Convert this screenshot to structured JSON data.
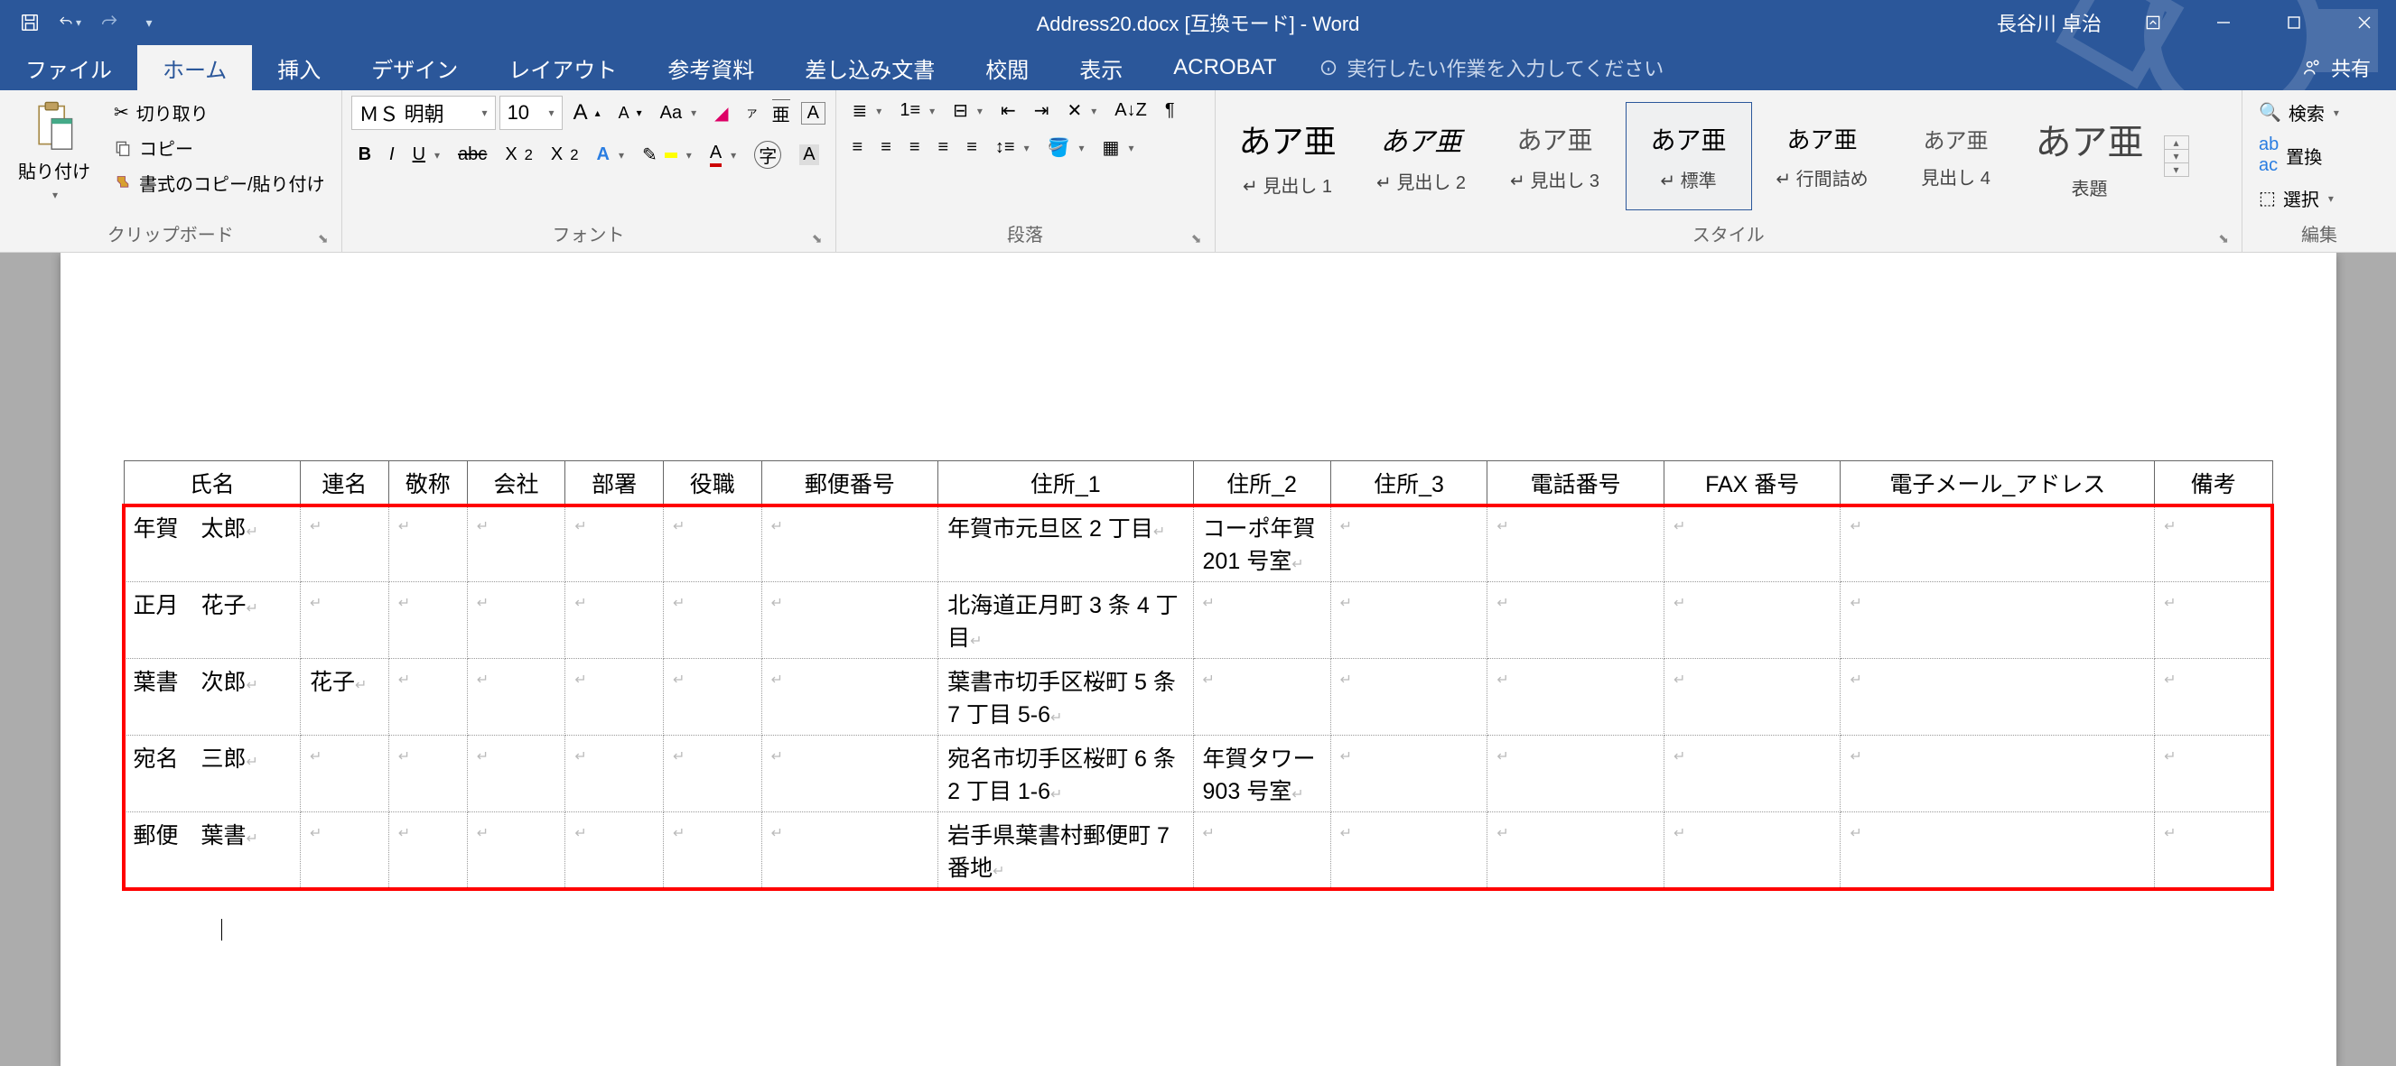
{
  "title": "Address20.docx [互換モード] - Word",
  "user": "長谷川 卓治",
  "qat": {
    "save": "保存",
    "undo": "元に戻す",
    "redo": "やり直し"
  },
  "tabs": {
    "file": "ファイル",
    "home": "ホーム",
    "insert": "挿入",
    "design": "デザイン",
    "layout": "レイアウト",
    "references": "参考資料",
    "mailings": "差し込み文書",
    "review": "校閲",
    "view": "表示",
    "acrobat": "ACROBAT",
    "tellme": "実行したい作業を入力してください",
    "share": "共有"
  },
  "ribbon": {
    "clipboard": {
      "label": "クリップボード",
      "paste": "貼り付け",
      "cut": "切り取り",
      "copy": "コピー",
      "format_painter": "書式のコピー/貼り付け"
    },
    "font": {
      "label": "フォント",
      "name": "ＭＳ 明朝",
      "size": "10"
    },
    "paragraph": {
      "label": "段落"
    },
    "styles": {
      "label": "スタイル",
      "items": [
        {
          "preview": "あア亜",
          "name": "↵ 見出し 1",
          "cls": "h1"
        },
        {
          "preview": "あア亜",
          "name": "↵ 見出し 2",
          "cls": "h2"
        },
        {
          "preview": "あア亜",
          "name": "↵ 見出し 3",
          "cls": "h3"
        },
        {
          "preview": "あア亜",
          "name": "↵ 標準",
          "cls": "normal",
          "selected": true
        },
        {
          "preview": "あア亜",
          "name": "↵ 行間詰め",
          "cls": "nosp"
        },
        {
          "preview": "あア亜",
          "name": "見出し 4",
          "cls": "h4"
        },
        {
          "preview": "あア亜",
          "name": "表題",
          "cls": "title"
        }
      ]
    },
    "editing": {
      "label": "編集",
      "find": "検索",
      "replace": "置換",
      "select": "選択"
    }
  },
  "table": {
    "headers": [
      "氏名",
      "連名",
      "敬称",
      "会社",
      "部署",
      "役職",
      "郵便番号",
      "住所_1",
      "住所_2",
      "住所_3",
      "電話番号",
      "FAX 番号",
      "電子メール_アドレス",
      "備考"
    ],
    "rows": [
      {
        "name": "年賀　太郎",
        "ren": "",
        "addr1": "年賀市元旦区 2 丁目",
        "addr2": "コーポ年賀 201 号室"
      },
      {
        "name": "正月　花子",
        "ren": "",
        "addr1": "北海道正月町 3 条 4 丁目",
        "addr2": ""
      },
      {
        "name": "葉書　次郎",
        "ren": "花子",
        "addr1": "葉書市切手区桜町 5 条 7 丁目 5-6",
        "addr2": ""
      },
      {
        "name": "宛名　三郎",
        "ren": "",
        "addr1": "宛名市切手区桜町 6 条 2 丁目 1-6",
        "addr2": "年賀タワー903 号室"
      },
      {
        "name": "郵便　葉書",
        "ren": "",
        "addr1": "岩手県葉書村郵便町 7 番地",
        "addr2": ""
      }
    ]
  }
}
